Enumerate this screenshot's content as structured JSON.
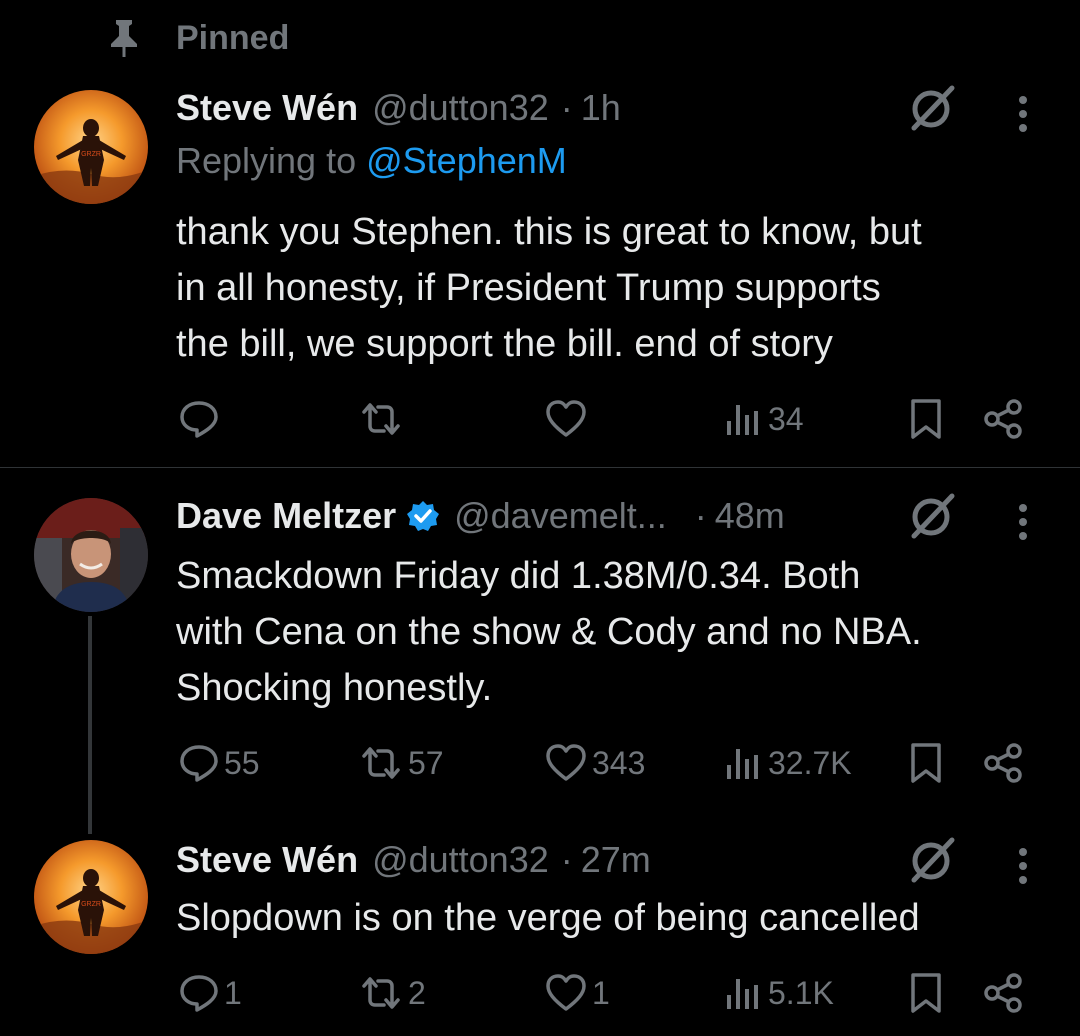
{
  "pinned": {
    "label": "Pinned",
    "icon": "pin-icon"
  },
  "tweets": [
    {
      "name": "Steve Wén",
      "handle": "@dutton32",
      "sep": "·",
      "time": "1h",
      "verified": false,
      "replying_prefix": "Replying to",
      "replying_to": "@StephenM",
      "lines": [
        "thank you Stephen. this is great to know, but",
        "in all honesty, if President Trump supports",
        "the bill, we support the bill. end of story"
      ],
      "stats": {
        "replies": "",
        "reposts": "",
        "likes": "",
        "views": "34"
      }
    },
    {
      "name": "Dave Meltzer",
      "handle": "@davemelt...",
      "sep": "·",
      "time": "48m",
      "verified": true,
      "lines": [
        "Smackdown Friday did 1.38M/0.34.  Both",
        "with Cena on the show & Cody and no NBA.",
        "Shocking honestly."
      ],
      "stats": {
        "replies": "55",
        "reposts": "57",
        "likes": "343",
        "views": "32.7K"
      }
    },
    {
      "name": "Steve Wén",
      "handle": "@dutton32",
      "sep": "·",
      "time": "27m",
      "verified": false,
      "lines": [
        "Slopdown is on the verge of being cancelled"
      ],
      "stats": {
        "replies": "1",
        "reposts": "2",
        "likes": "1",
        "views": "5.1K"
      }
    }
  ],
  "colors": {
    "background": "#000000",
    "text": "#e7e9ea",
    "muted": "#71767b",
    "accent": "#1d9bf0",
    "divider": "#2f3336"
  }
}
